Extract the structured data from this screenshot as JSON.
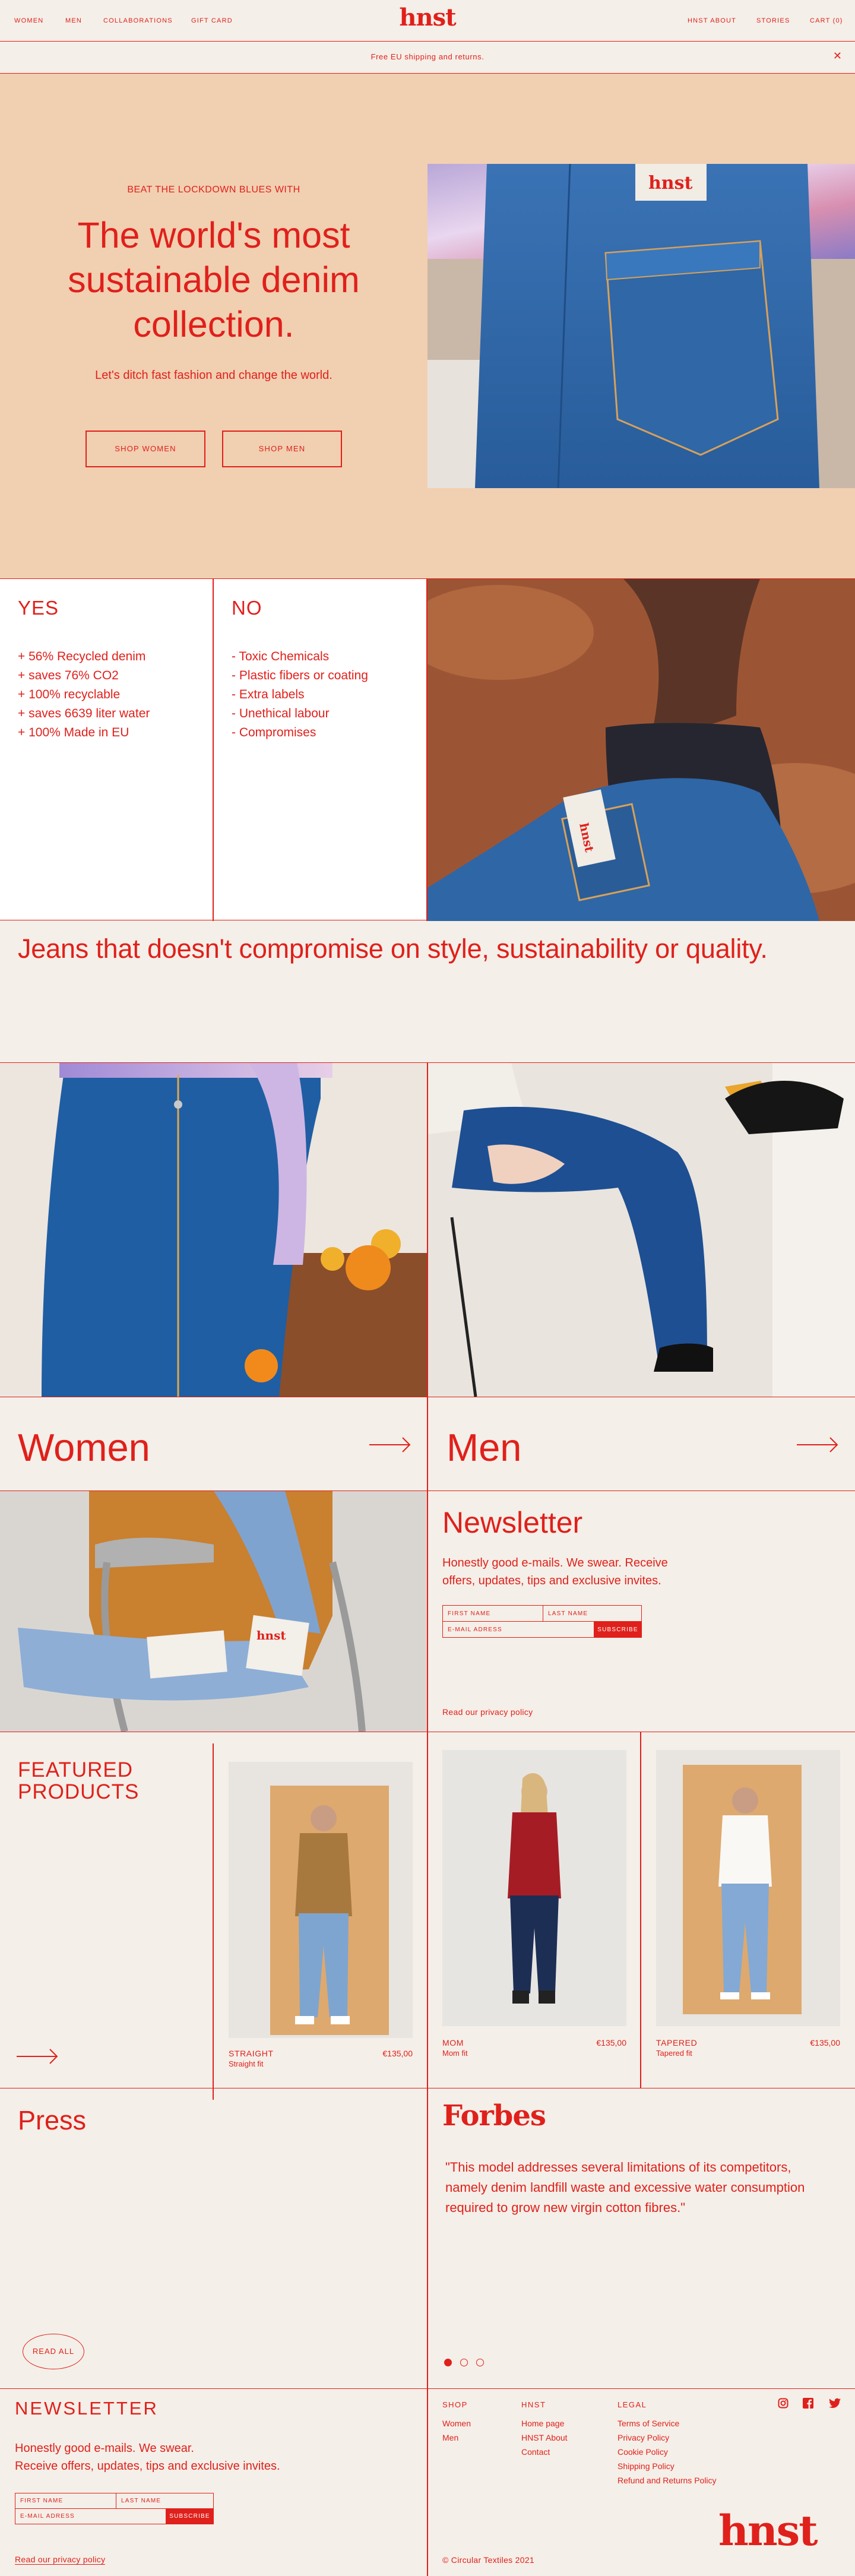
{
  "colors": {
    "accent": "#e0201b",
    "cream": "#f4efe8",
    "peach": "#f1cfb1"
  },
  "header": {
    "nav_left": [
      "WOMEN",
      "MEN",
      "COLLABORATIONS",
      "GIFT CARD"
    ],
    "logo": "hnst",
    "nav_right": [
      "HNST ABOUT",
      "STORIES",
      "CART (0)"
    ]
  },
  "banner": {
    "text": "Free EU shipping and returns.",
    "close_icon": "close-icon"
  },
  "hero": {
    "eyebrow": "BEAT THE LOCKDOWN BLUES WITH",
    "title": "The world's most sustainable denim collection.",
    "subtitle": "Let's ditch fast fashion and change the world.",
    "buttons": [
      "SHOP WOMEN",
      "SHOP MEN"
    ],
    "label": "hnst"
  },
  "values": {
    "yes_title": "YES",
    "yes_items": [
      "+ 56% Recycled denim",
      "+ saves 76% CO2",
      "+ 100% recyclable",
      "+ saves 6639 liter water",
      "+ 100% Made in EU"
    ],
    "no_title": "NO",
    "no_items": [
      "- Toxic Chemicals",
      "- Plastic fibers or coating",
      "- Extra labels",
      "- Unethical labour",
      "- Compromises"
    ],
    "label": "hnst"
  },
  "tagline": "Jeans that doesn't compromise on style, sustainability or quality.",
  "categories": [
    {
      "label": "Women",
      "icon": "arrow-right-icon"
    },
    {
      "label": "Men",
      "icon": "arrow-right-icon"
    }
  ],
  "newsletter": {
    "title": "Newsletter",
    "text": "Honestly good e-mails. We swear. Receive offers, updates, tips and exclusive invites.",
    "first_name_placeholder": "FIRST NAME",
    "last_name_placeholder": "LAST NAME",
    "email_placeholder": "E-MAIL ADRESS",
    "subscribe": "SUBSCRIBE",
    "privacy": "Read our privacy policy",
    "label": "hnst"
  },
  "featured": {
    "title": "FEATURED PRODUCTS",
    "arrow_icon": "arrow-right-icon",
    "products": [
      {
        "name": "STRAIGHT",
        "fit": "Straight fit",
        "price": "€135,00"
      },
      {
        "name": "MOM",
        "fit": "Mom fit",
        "price": "€135,00"
      },
      {
        "name": "TAPERED",
        "fit": "Tapered fit",
        "price": "€135,00"
      }
    ]
  },
  "press": {
    "title": "Press",
    "read_all": "READ ALL",
    "source": "Forbes",
    "quote": "\"This model addresses several limitations of its competitors, namely denim landfill waste and excessive water consumption required to grow new virgin cotton fibres.\"",
    "slides_total": 3,
    "slide_active": 1
  },
  "footer": {
    "newsletter_title": "NEWSLETTER",
    "newsletter_text_1": "Honestly good e-mails. We swear.",
    "newsletter_text_2": "Receive offers, updates, tips and exclusive invites.",
    "first_name_placeholder": "FIRST NAME",
    "last_name_placeholder": "LAST NAME",
    "email_placeholder": "E-MAIL ADRESS",
    "subscribe": "SUBSCRIBE",
    "privacy": "Read our privacy policy",
    "columns": [
      {
        "title": "SHOP",
        "links": [
          "Women",
          "Men"
        ]
      },
      {
        "title": "HNST",
        "links": [
          "Home page",
          "HNST About",
          "Contact"
        ]
      },
      {
        "title": "LEGAL",
        "links": [
          "Terms of Service",
          "Privacy Policy",
          "Cookie Policy",
          "Shipping Policy",
          "Refund and Returns Policy"
        ]
      }
    ],
    "social_icons": [
      "instagram-icon",
      "facebook-icon",
      "twitter-icon"
    ],
    "copyright": "© Circular Textiles 2021",
    "logo": "hnst"
  }
}
